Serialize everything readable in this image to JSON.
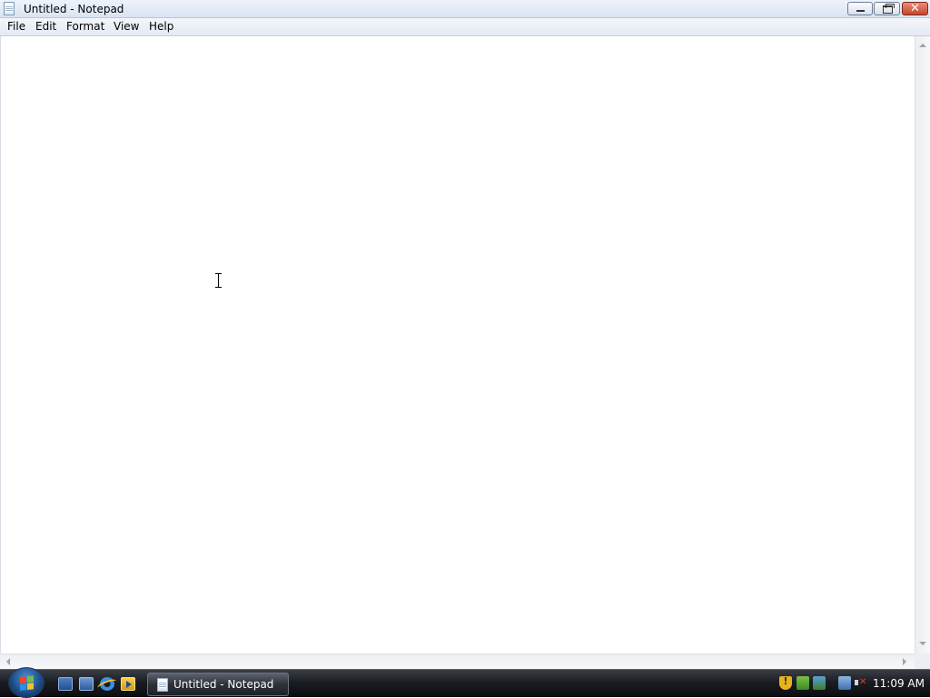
{
  "window": {
    "title": "Untitled - Notepad",
    "icon": "notepad-icon",
    "controls": [
      "minimize",
      "maximize",
      "close"
    ]
  },
  "menu": {
    "items": [
      {
        "label": "File"
      },
      {
        "label": "Edit"
      },
      {
        "label": "Format"
      },
      {
        "label": "View"
      },
      {
        "label": "Help"
      }
    ]
  },
  "editor": {
    "text": "",
    "cursor": "i-beam"
  },
  "taskbar": {
    "start": "windows-start-orb",
    "quick_launch": [
      "show-desktop-icon",
      "switch-windows-icon",
      "internet-explorer-icon",
      "media-player-icon"
    ],
    "tasks": [
      {
        "label": "Untitled - Notepad",
        "icon": "notepad-icon",
        "active": true
      }
    ],
    "tray_icons": [
      "security-warning-icon",
      "sync-icon",
      "status-icon",
      "network-icon",
      "volume-muted-icon"
    ],
    "clock": "11:09 AM"
  },
  "colors": {
    "titlebar": "#d9e4f1",
    "close_button": "#c9442a",
    "taskbar": "#1a1d22"
  }
}
